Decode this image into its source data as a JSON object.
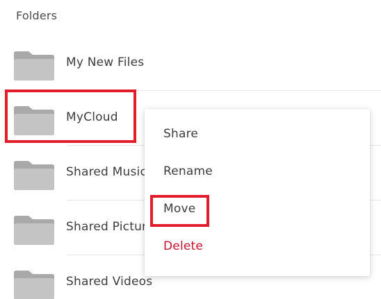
{
  "section": {
    "title": "Folders"
  },
  "folders": [
    {
      "name": "My New Files",
      "icon": "folder-icon"
    },
    {
      "name": "MyCloud",
      "icon": "folder-icon"
    },
    {
      "name": "Shared Music",
      "icon": "folder-icon"
    },
    {
      "name": "Shared Pictures",
      "icon": "folder-icon"
    },
    {
      "name": "Shared Videos",
      "icon": "folder-icon"
    }
  ],
  "context_menu": {
    "items": [
      {
        "label": "Share"
      },
      {
        "label": "Rename"
      },
      {
        "label": "Move"
      },
      {
        "label": "Delete"
      }
    ]
  },
  "colors": {
    "highlight": "#e11d2a",
    "danger": "#c8102e",
    "folder_back": "#a9a9a9",
    "folder_front": "#c4c4c4"
  }
}
